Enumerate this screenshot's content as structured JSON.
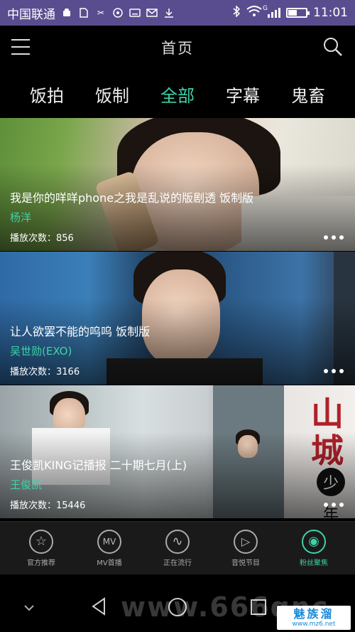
{
  "status_bar": {
    "carrier": "中国联通",
    "time": "11:01",
    "signal_label": "G"
  },
  "header": {
    "title": "首页"
  },
  "tabs": [
    {
      "label": "饭拍",
      "active": false
    },
    {
      "label": "饭制",
      "active": false
    },
    {
      "label": "全部",
      "active": true
    },
    {
      "label": "字幕",
      "active": false
    },
    {
      "label": "鬼畜",
      "active": false
    }
  ],
  "feed": [
    {
      "title": "我是你的咩咩phone之我是乱说的版剧透 饭制版",
      "artist": "杨洋",
      "plays": "播放次数：856"
    },
    {
      "title": "让人欲罢不能的呜呜 饭制版",
      "artist": "吴世勋(EXO)",
      "plays": "播放次数：3166"
    },
    {
      "title": "王俊凯KING记播报 二十期七月(上)",
      "artist": "王俊凯",
      "plays": "播放次数：15446"
    }
  ],
  "card3_art": {
    "char1": "山",
    "char2": "城",
    "char3": "少",
    "char4": "年"
  },
  "bottom_nav": [
    {
      "label": "官方推荐",
      "icon": "star-icon",
      "glyph": "☆",
      "active": false
    },
    {
      "label": "MV首播",
      "icon": "mv-icon",
      "glyph": "MV",
      "active": false
    },
    {
      "label": "正在流行",
      "icon": "trend-icon",
      "glyph": "∿",
      "active": false
    },
    {
      "label": "音悦节目",
      "icon": "play-icon",
      "glyph": "▷",
      "active": false
    },
    {
      "label": "粉丝聚焦",
      "icon": "fans-icon",
      "glyph": "◉",
      "active": true
    }
  ],
  "watermark": "www.666qnc",
  "brand": {
    "name": "魅族溜",
    "url": "www.mz6.net"
  },
  "colors": {
    "accent": "#3ed3a8",
    "status_bar": "#5a4d8f"
  }
}
